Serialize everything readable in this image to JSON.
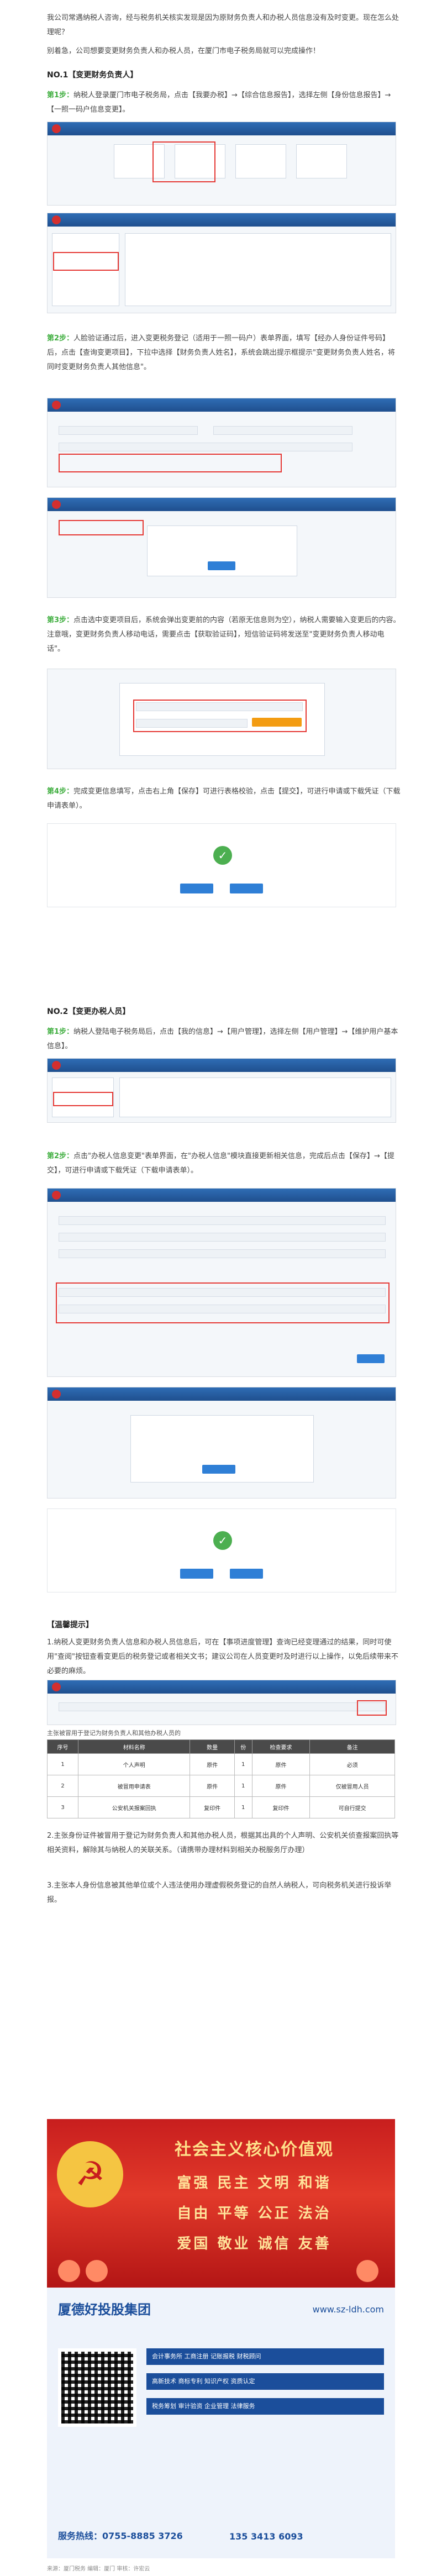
{
  "intro": {
    "p1": "我公司常遇纳税人咨询，经与税务机关核实发现是因为原财务负责人和办税人员信息没有及时变更。现在怎么处理呢？",
    "p2": "别着急，公司想要变更财务负责人和办税人员，在厦门市电子税务局就可以完成操作！"
  },
  "section1": {
    "heading": "NO.1【变更财务负责人】",
    "step1_label": "第1步：",
    "step1": "纳税人登录厦门市电子税务局，点击【我要办税】→【综合信息报告】，选择左侧【身份信息报告】→【一照一码户信息变更】。",
    "step2_label": "第2步：",
    "step2": "人脸验证通过后，进入变更税务登记（适用于一照一码户）表单界面，填写【经办人身份证件号码】后，点击【查询变更项目】，下拉中选择【财务负责人姓名】，系统会跳出提示框提示\"变更财务负责人姓名，将同时变更财务负责人其他信息\"。",
    "step3_label": "第3步：",
    "step3": "点击选中变更项目后，系统会弹出变更前的内容（若原无信息则为空），纳税人需要输入变更后的内容。注意哦，变更财务负责人移动电话，需要点击【获取验证码】，短信验证码将发送至\"变更财务负责人移动电话\"。",
    "step4_label": "第4步：",
    "step4": "完成变更信息填写，点击右上角【保存】可进行表格校验，点击【提交】，可进行申请或下载凭证（下载申请表单）。"
  },
  "section2": {
    "heading": "NO.2【变更办税人员】",
    "step1_label": "第1步：",
    "step1": "纳税人登陆电子税务局后，点击【我的信息】→【用户管理】，选择左侧【用户管理】→【维护用户基本信息】。",
    "step2_label": "第2步：",
    "step2": "点击\"办税人信息变更\"表单界面，在\"办税人信息\"模块直接更新相关信息，完成后点击【保存】→【提交】，可进行申请或下载凭证（下载申请表单）。"
  },
  "notes": {
    "heading": "【温馨提示】",
    "n1": "1.纳税人变更财务负责人信息和办税人员信息后，可在【事项进度管理】查询已经变理通过的结果，同时可使用\"查阅\"按钮查看变更后的税务登记或者相关文书；建议公司在人员变更时及时进行以上操作，以免后续带来不必要的麻烦。",
    "n2": "2.主张身份证件被冒用于登记为财务负责人和其他办税人员，根据其出具的个人声明、公安机关侦查报案回执等相关资料，解除其与纳税人的关联关系。（请携带办理材料到相关办税服务厅办理）",
    "table_caption": "主张被冒用于登记为财务负责人和其他办税人员的",
    "table_headers": [
      "序号",
      "材料名称",
      "数量",
      "份",
      "检查要求",
      "备注"
    ],
    "table_rows": [
      [
        "1",
        "个人声明",
        "原件",
        "1",
        "原件",
        "必须"
      ],
      [
        "2",
        "被冒用申请表",
        "原件",
        "1",
        "原件",
        "仅被冒用人员"
      ],
      [
        "3",
        "公安机关报案回执",
        "复印件",
        "1",
        "复印件",
        "可自行提交"
      ]
    ],
    "n3": "3.主张本人身份信息被其他单位或个人违法使用办理虚假税务登记的自然人纳税人，可向税务机关进行投诉举报。"
  },
  "banner": {
    "title": "社会主义核心价值观",
    "row1": "富强 民主 文明 和谐",
    "row2": "自由 平等 公正 法治",
    "row3": "爱国 敬业 诚信 友善"
  },
  "ad": {
    "brand": "厦德好投股集团",
    "url": "www.sz-ldh.com",
    "services": [
      "会计事务所 工商注册 记账报税 财税顾问",
      "高新技术 商标专利 知识产权 资质认定",
      "税务筹划 审计验资 企业管理 法律服务"
    ],
    "phone": "服务热线：0755-8885 3726",
    "mobile": "135 3413 6093"
  },
  "footer": "来源：厦门税务  编辑：厦门 审核：许宏云",
  "colors": {
    "green": "#3fae3f",
    "blue": "#1f4f8e",
    "red": "#e53935"
  }
}
